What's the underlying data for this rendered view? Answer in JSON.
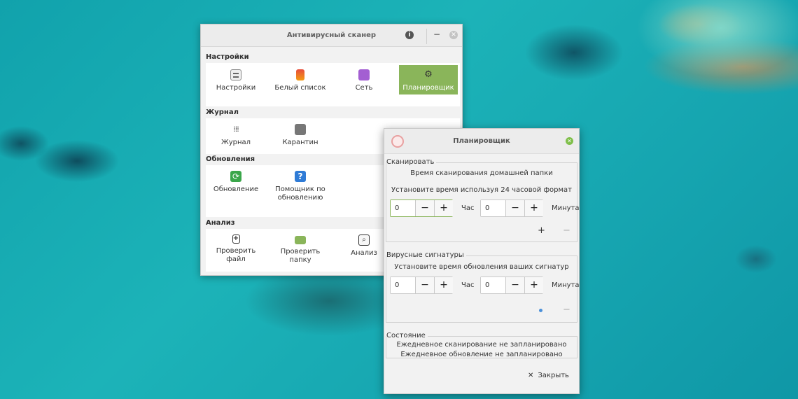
{
  "main_window": {
    "title": "Антивирусный сканер",
    "info_label": "i",
    "minimize_label": "−",
    "close_label": "✕",
    "sections": {
      "settings": {
        "header": "Настройки",
        "items": [
          "Настройки",
          "Белый список",
          "Сеть",
          "Планировщик"
        ]
      },
      "journal": {
        "header": "Журнал",
        "items": [
          "Журнал",
          "Карантин"
        ]
      },
      "updates": {
        "header": "Обновления",
        "items": [
          "Обновление",
          "Помощник по обновлению"
        ]
      },
      "analysis": {
        "header": "Анализ",
        "items": [
          "Проверить файл",
          "Проверить папку",
          "Анализ"
        ]
      }
    }
  },
  "scheduler": {
    "title": "Планировщик",
    "scan": {
      "legend": "Сканировать",
      "line1": "Время сканирования домашней папки",
      "line2": "Установите время используя 24 часовой формат",
      "hour_value": "0",
      "minute_value": "0",
      "hour_label": "Час",
      "minute_label": "Минута",
      "minus": "−",
      "plus": "+"
    },
    "signatures": {
      "legend": "Вирусные сигнатуры",
      "line1": "Установите время обновления ваших сигнатур",
      "hour_value": "0",
      "minute_value": "0",
      "hour_label": "Час",
      "minute_label": "Минута",
      "minus": "−",
      "plus": "+"
    },
    "status": {
      "legend": "Состояние",
      "line1": "Ежедневное сканирование не запланировано",
      "line2": "Ежедневное обновление не запланировано"
    },
    "close_label": "Закрыть",
    "accent_color": "#8ab55a"
  }
}
